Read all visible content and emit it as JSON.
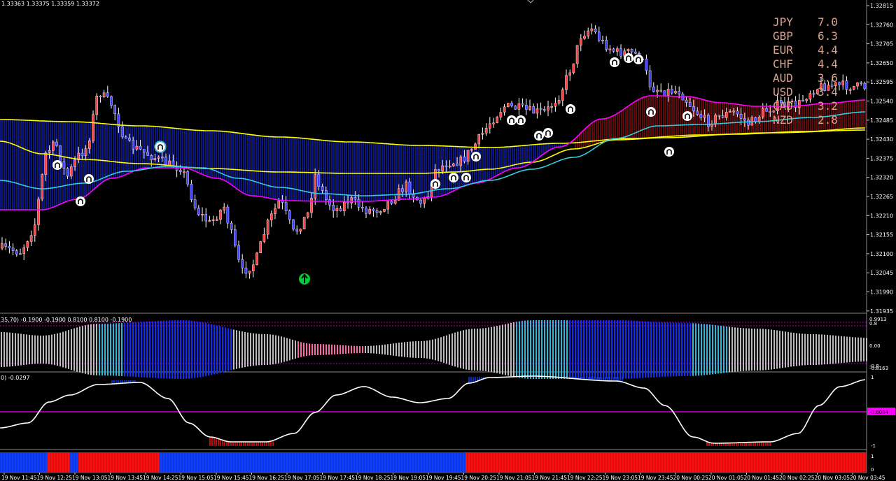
{
  "colors": {
    "background": "#000000",
    "axis": "#ffffff",
    "candle_bull": "#ff4040",
    "candle_bear": "#4040ff",
    "ma_yellow": "#ffff00",
    "ma_magenta": "#ff00ff",
    "ma_cyan": "#33ccdd",
    "cloud_blue": "#1a2fff",
    "cloud_red": "#c01818",
    "signal_white": "#ffffff",
    "signal_green": "#00cc33",
    "osc_gray": "#bbbbbb",
    "osc_blue": "#1030ff",
    "osc_cyan": "#22bbdd",
    "osc_pink": "#ff66aa",
    "line_white": "#ffffff",
    "level_magenta": "#ff00ff",
    "bar_red": "#ff1010",
    "bar_blue": "#1040ff"
  },
  "main_panel": {
    "ohlc_text": "1.33363 1.33375 1.33359 1.33372",
    "price_ticks": [
      "1.32815",
      "1.32760",
      "1.32705",
      "1.32650",
      "1.32595",
      "1.32540",
      "1.32485",
      "1.32430",
      "1.32375",
      "1.32320",
      "1.32265",
      "1.32210",
      "1.32155",
      "1.32100",
      "1.32045",
      "1.31990",
      "1.31935"
    ]
  },
  "strength_table": [
    {
      "currency": "JPY",
      "value": "7.0"
    },
    {
      "currency": "GBP",
      "value": "6.3"
    },
    {
      "currency": "EUR",
      "value": "4.4"
    },
    {
      "currency": "CHF",
      "value": "4.4"
    },
    {
      "currency": "AUD",
      "value": "3.6"
    },
    {
      "currency": "USD",
      "value": "3.4"
    },
    {
      "currency": "CAD",
      "value": "3.2"
    },
    {
      "currency": "NZD",
      "value": "2.8"
    }
  ],
  "panel1": {
    "label": "35,70) -0.1900 -0.1900 0.8100 0.8100 -0.1900",
    "ticks": {
      "top": "0.9913",
      "upper": "0.8",
      "mid": "0.00",
      "lower": "-0.8",
      "bottom": "-0.8163"
    }
  },
  "panel2": {
    "label": "0) -0.0297",
    "ticks": {
      "top": "1",
      "level": "-0.0084",
      "bottom": "-1"
    }
  },
  "panel3": {
    "ticks": {
      "top": "1",
      "bottom": "0"
    }
  },
  "time_labels": [
    "19 Nov 11:45",
    "19 Nov 12:25",
    "19 Nov 13:05",
    "19 Nov 13:45",
    "19 Nov 14:25",
    "19 Nov 15:05",
    "19 Nov 15:45",
    "19 Nov 16:25",
    "19 Nov 17:05",
    "19 Nov 17:45",
    "19 Nov 18:25",
    "19 Nov 19:05",
    "19 Nov 19:45",
    "19 Nov 20:25",
    "19 Nov 21:05",
    "19 Nov 21:45",
    "19 Nov 22:25",
    "19 Nov 23:05",
    "19 Nov 23:45",
    "20 Nov 00:25",
    "20 Nov 01:05",
    "20 Nov 01:45",
    "20 Nov 02:25",
    "20 Nov 03:05",
    "20 Nov 03:45"
  ]
}
